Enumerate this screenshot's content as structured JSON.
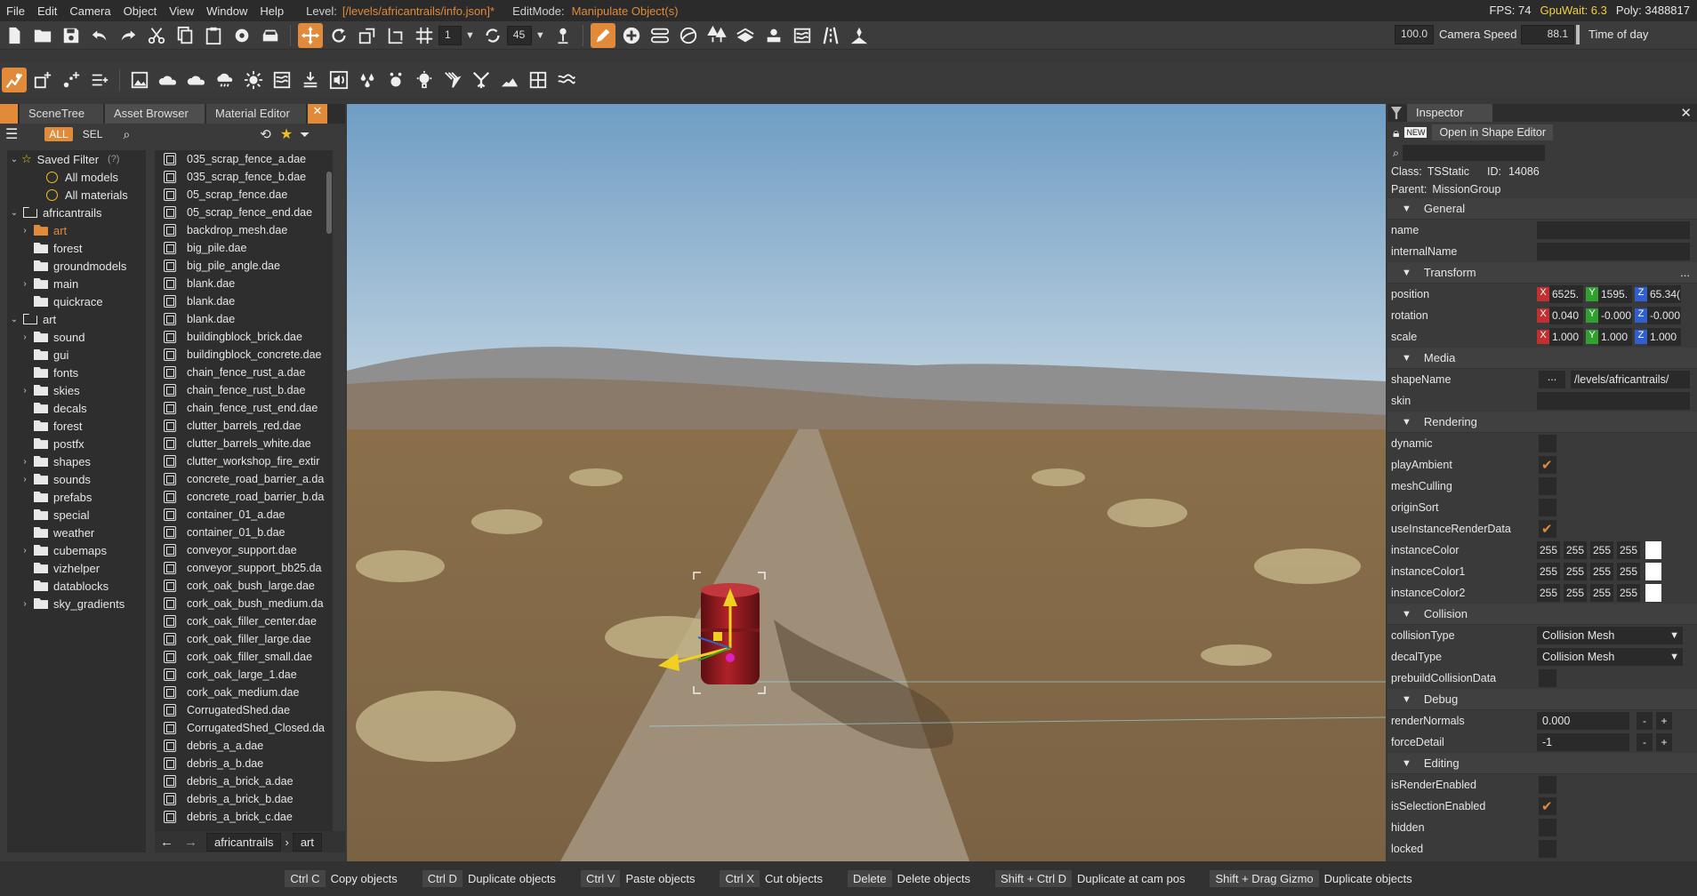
{
  "menubar": {
    "items": [
      "File",
      "Edit",
      "Camera",
      "Object",
      "View",
      "Window",
      "Help"
    ],
    "level_label": "Level:",
    "level_path": "[/levels/africantrails/info.json]*",
    "editmode_label": "EditMode:",
    "editmode_value": "Manipulate Object(s)",
    "fps": "FPS: 74",
    "gpuwait": "GpuWait: 6.3",
    "poly": "Poly: 3488817"
  },
  "toolbar": {
    "snap_value": "1",
    "angle_value": "45",
    "camera_speed_value": "100.0",
    "camera_speed_label": "Camera Speed",
    "time_of_day_value": "88.1",
    "time_of_day_label": "Time of day"
  },
  "left_panel": {
    "tabs": [
      "SceneTree",
      "Asset Browser",
      "Material Editor"
    ],
    "filter_all": "ALL",
    "filter_sel": "SEL",
    "tree": [
      {
        "label": "Saved Filter",
        "hint": "(?)",
        "kind": "star",
        "arrow": "⌄",
        "indent": 0
      },
      {
        "label": "All models",
        "kind": "smile",
        "arrow": "",
        "indent": 1
      },
      {
        "label": "All materials",
        "kind": "smile",
        "arrow": "",
        "indent": 1
      },
      {
        "label": "africantrails",
        "kind": "folder-outline",
        "arrow": "⌄",
        "indent": 0
      },
      {
        "label": "art",
        "kind": "folder-orange",
        "arrow": "›",
        "indent": 1
      },
      {
        "label": "forest",
        "kind": "folder",
        "arrow": "",
        "indent": 1
      },
      {
        "label": "groundmodels",
        "kind": "folder",
        "arrow": "",
        "indent": 1
      },
      {
        "label": "main",
        "kind": "folder",
        "arrow": "›",
        "indent": 1
      },
      {
        "label": "quickrace",
        "kind": "folder",
        "arrow": "",
        "indent": 1
      },
      {
        "label": "art",
        "kind": "folder-outline",
        "arrow": "⌄",
        "indent": 0
      },
      {
        "label": "sound",
        "kind": "folder",
        "arrow": "›",
        "indent": 1
      },
      {
        "label": "gui",
        "kind": "folder",
        "arrow": "",
        "indent": 1
      },
      {
        "label": "fonts",
        "kind": "folder",
        "arrow": "",
        "indent": 1
      },
      {
        "label": "skies",
        "kind": "folder",
        "arrow": "›",
        "indent": 1
      },
      {
        "label": "decals",
        "kind": "folder",
        "arrow": "",
        "indent": 1
      },
      {
        "label": "forest",
        "kind": "folder",
        "arrow": "",
        "indent": 1
      },
      {
        "label": "postfx",
        "kind": "folder",
        "arrow": "",
        "indent": 1
      },
      {
        "label": "shapes",
        "kind": "folder",
        "arrow": "›",
        "indent": 1
      },
      {
        "label": "sounds",
        "kind": "folder",
        "arrow": "›",
        "indent": 1
      },
      {
        "label": "prefabs",
        "kind": "folder",
        "arrow": "",
        "indent": 1
      },
      {
        "label": "special",
        "kind": "folder",
        "arrow": "",
        "indent": 1
      },
      {
        "label": "weather",
        "kind": "folder",
        "arrow": "",
        "indent": 1
      },
      {
        "label": "cubemaps",
        "kind": "folder",
        "arrow": "›",
        "indent": 1
      },
      {
        "label": "vizhelper",
        "kind": "folder",
        "arrow": "",
        "indent": 1
      },
      {
        "label": "datablocks",
        "kind": "folder",
        "arrow": "",
        "indent": 1
      },
      {
        "label": "sky_gradients",
        "kind": "folder",
        "arrow": "›",
        "indent": 1
      }
    ],
    "files": [
      "035_scrap_fence_a.dae",
      "035_scrap_fence_b.dae",
      "05_scrap_fence.dae",
      "05_scrap_fence_end.dae",
      "backdrop_mesh.dae",
      "big_pile.dae",
      "big_pile_angle.dae",
      "blank.dae",
      "blank.dae",
      "blank.dae",
      "buildingblock_brick.dae",
      "buildingblock_concrete.dae",
      "chain_fence_rust_a.dae",
      "chain_fence_rust_b.dae",
      "chain_fence_rust_end.dae",
      "clutter_barrels_red.dae",
      "clutter_barrels_white.dae",
      "clutter_workshop_fire_extir",
      "concrete_road_barrier_a.da",
      "concrete_road_barrier_b.da",
      "container_01_a.dae",
      "container_01_b.dae",
      "conveyor_support.dae",
      "conveyor_support_bb25.da",
      "cork_oak_bush_large.dae",
      "cork_oak_bush_medium.da",
      "cork_oak_filler_center.dae",
      "cork_oak_filler_large.dae",
      "cork_oak_filler_small.dae",
      "cork_oak_large_1.dae",
      "cork_oak_medium.dae",
      "CorrugatedShed.dae",
      "CorrugatedShed_Closed.da",
      "debris_a_a.dae",
      "debris_a_b.dae",
      "debris_a_brick_a.dae",
      "debris_a_brick_b.dae",
      "debris_a_brick_c.dae"
    ],
    "crumbs": [
      "africantrails",
      "art"
    ]
  },
  "inspector": {
    "title": "Inspector",
    "open_shape_editor": "Open in Shape Editor",
    "new_badge": "NEW",
    "class_label": "Class:",
    "class_value": "TSStatic",
    "id_label": "ID:",
    "id_value": "14086",
    "parent_label": "Parent:",
    "parent_value": "MissionGroup",
    "sections": {
      "general": "General",
      "transform": "Transform",
      "media": "Media",
      "rendering": "Rendering",
      "collision": "Collision",
      "debug": "Debug",
      "editing": "Editing"
    },
    "fields": {
      "name": "name",
      "internalName": "internalName",
      "position": "position",
      "rotation": "rotation",
      "scale": "scale",
      "shapeName": "shapeName",
      "skin": "skin",
      "dynamic": "dynamic",
      "playAmbient": "playAmbient",
      "meshCulling": "meshCulling",
      "originSort": "originSort",
      "useInstanceRenderData": "useInstanceRenderData",
      "instanceColor": "instanceColor",
      "instanceColor1": "instanceColor1",
      "instanceColor2": "instanceColor2",
      "collisionType": "collisionType",
      "decalType": "decalType",
      "prebuildCollisionData": "prebuildCollisionData",
      "renderNormals": "renderNormals",
      "forceDetail": "forceDetail",
      "isRenderEnabled": "isRenderEnabled",
      "isSelectionEnabled": "isSelectionEnabled",
      "hidden": "hidden",
      "locked": "locked"
    },
    "values": {
      "position": [
        "6525.",
        "1595.",
        "65.34("
      ],
      "rotation": [
        "0.040",
        "-0.000",
        "-0.000"
      ],
      "scale": [
        "1.000",
        "1.000",
        "1.000"
      ],
      "shapeName": "/levels/africantrails/",
      "shape_browse": "...",
      "transform_more": "...",
      "color": [
        "255",
        "255",
        "255",
        "255"
      ],
      "collisionType": "Collision Mesh",
      "decalType": "Collision Mesh",
      "renderNormals": "0.000",
      "forceDetail": "-1",
      "minus": "-",
      "plus": "+"
    },
    "checks": {
      "dynamic": false,
      "playAmbient": true,
      "meshCulling": false,
      "originSort": false,
      "useInstanceRenderData": true,
      "prebuildCollisionData": false,
      "isRenderEnabled": false,
      "isSelectionEnabled": true,
      "hidden": false,
      "locked": false
    }
  },
  "statusbar": [
    {
      "key": "Ctrl C",
      "action": "Copy objects"
    },
    {
      "key": "Ctrl D",
      "action": "Duplicate objects"
    },
    {
      "key": "Ctrl V",
      "action": "Paste objects"
    },
    {
      "key": "Ctrl X",
      "action": "Cut objects"
    },
    {
      "key": "Delete",
      "action": "Delete objects"
    },
    {
      "key": "Shift + Ctrl D",
      "action": "Duplicate at cam pos"
    },
    {
      "key": "Shift + Drag Gizmo",
      "action": "Duplicate objects"
    }
  ],
  "colors": {
    "accent": "#e08a3a",
    "gpuwait": "#f0d040",
    "axis_x": "#c03030",
    "axis_y": "#30a030",
    "axis_z": "#3060d0"
  },
  "icons": {
    "toolbar1": [
      "new-file-icon",
      "open-folder-icon",
      "save-icon",
      "undo-icon",
      "redo-icon",
      "cut-icon",
      "copy-icon",
      "paste-icon",
      "settings-gear-icon",
      "car-icon",
      "move-gizmo-icon",
      "rotate-gizmo-icon",
      "scale-gizmo-icon",
      "snap-grid-icon",
      "grid-icon",
      "rotate-snap-icon",
      "drop-to-ground-icon",
      "pencil-edit-icon",
      "add-object-icon",
      "route-icon",
      "terrain-paint-icon",
      "forest-icon",
      "mesh-road-icon",
      "decal-icon",
      "river-icon",
      "bridge-icon",
      "navmesh-icon"
    ],
    "toolbar2": [
      "object-select-icon",
      "add-shape-icon",
      "add-node-icon",
      "add-list-icon",
      "image-icon",
      "cloud-layer-icon",
      "cloud-icon",
      "weather-icon",
      "sun-icon",
      "water-plane-icon",
      "ground-cover-icon",
      "sound-emitter-icon",
      "particle-icon",
      "point-light-icon",
      "spot-light-icon",
      "lightning-icon",
      "tree-icon",
      "terrain-icon",
      "grid-layout-icon",
      "wave-icon"
    ]
  }
}
